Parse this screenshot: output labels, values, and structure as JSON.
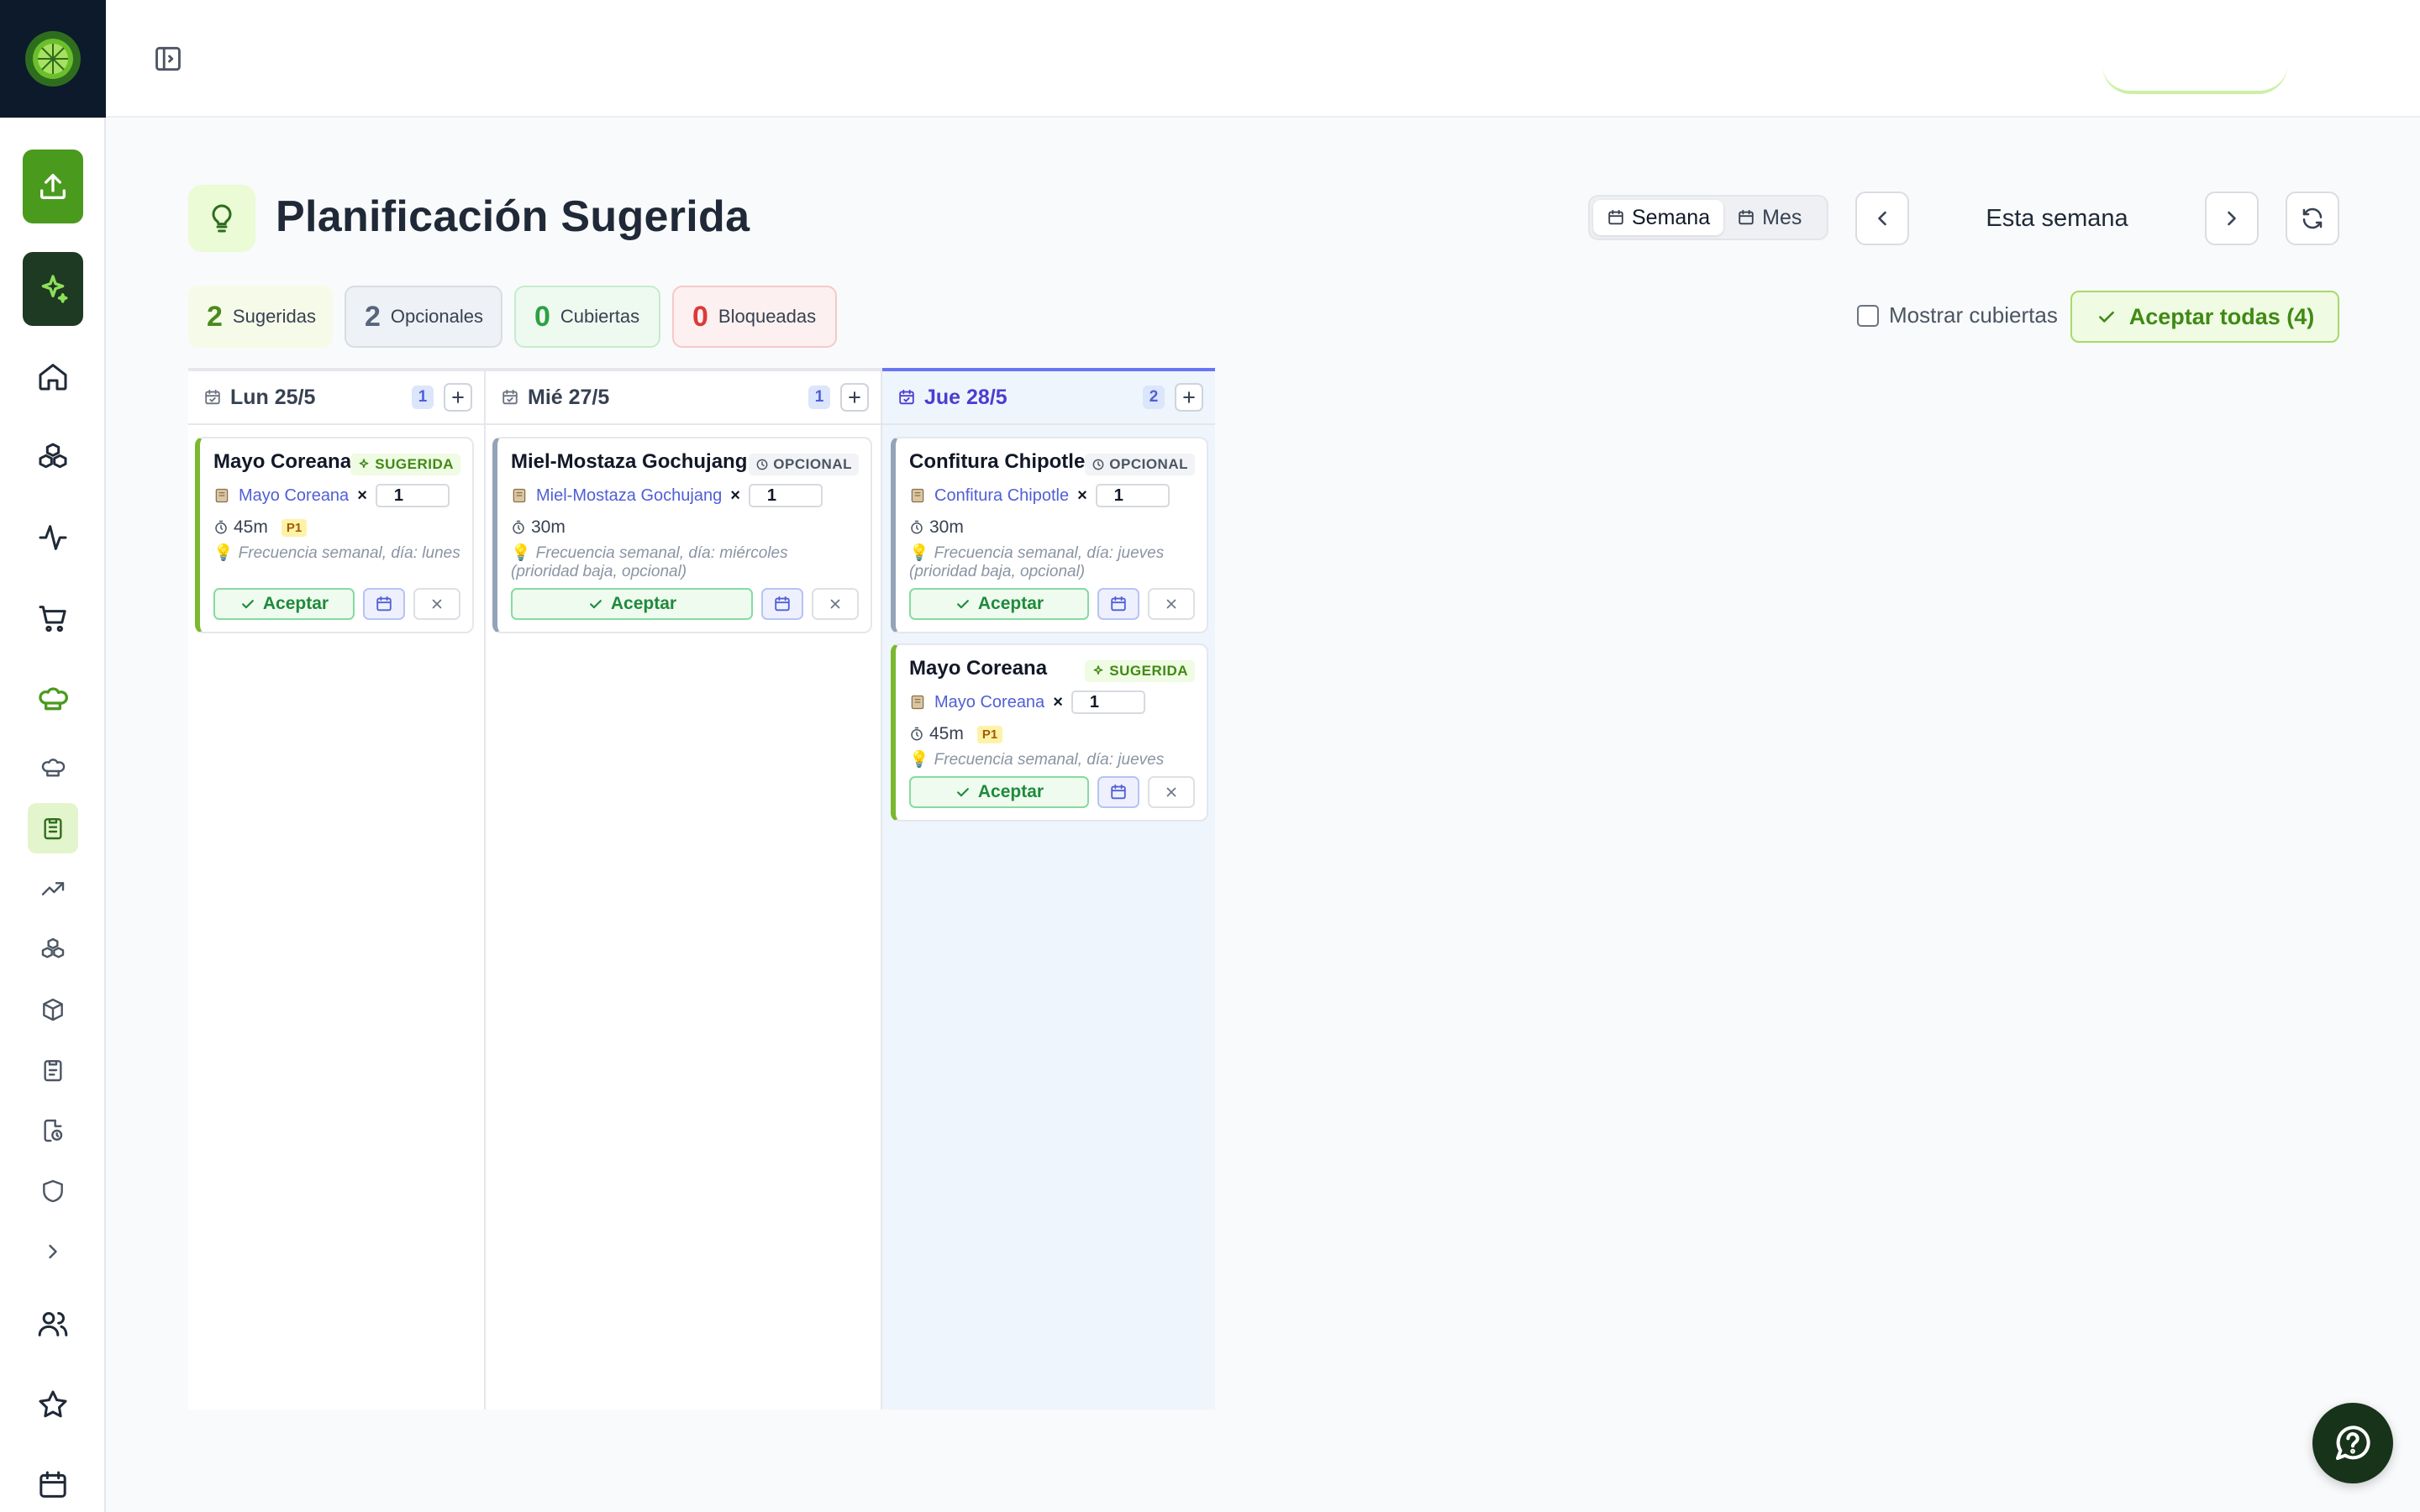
{
  "header": {
    "title": "Planificación Sugerida",
    "view_week": "Semana",
    "view_month": "Mes",
    "week_label": "Esta semana"
  },
  "stats": [
    {
      "num": "2",
      "label": "Sugeridas"
    },
    {
      "num": "2",
      "label": "Opcionales"
    },
    {
      "num": "0",
      "label": "Cubiertas"
    },
    {
      "num": "0",
      "label": "Bloqueadas"
    }
  ],
  "controls": {
    "show_covered": "Mostrar cubiertas",
    "accept_all": "Aceptar todas (4)"
  },
  "columns": [
    {
      "title": "Lun 25/5",
      "count": "1",
      "cards": [
        {
          "name": "Mayo Coreana",
          "badge": "SUGERIDA",
          "recipe": "Mayo Coreana",
          "qty": "1",
          "time": "45m",
          "priority": "P1",
          "reason": "Frecuencia semanal, día: lunes",
          "accept": "Aceptar"
        }
      ]
    },
    {
      "title": "Mié 27/5",
      "count": "1",
      "cards": [
        {
          "name": "Miel-Mostaza Gochujang",
          "badge": "OPCIONAL",
          "recipe": "Miel-Mostaza Gochujang",
          "qty": "1",
          "time": "30m",
          "reason": "Frecuencia semanal, día: miércoles (prioridad baja, opcional)",
          "accept": "Aceptar"
        }
      ]
    },
    {
      "title": "Jue 28/5",
      "count": "2",
      "cards": [
        {
          "name": "Confitura Chipotle",
          "badge": "OPCIONAL",
          "recipe": "Confitura Chipotle",
          "qty": "1",
          "time": "30m",
          "reason": "Frecuencia semanal, día: jueves (prioridad baja, opcional)",
          "accept": "Aceptar"
        },
        {
          "name": "Mayo Coreana",
          "badge": "SUGERIDA",
          "recipe": "Mayo Coreana",
          "qty": "1",
          "time": "45m",
          "priority": "P1",
          "reason": "Frecuencia semanal, día: jueves",
          "accept": "Aceptar"
        }
      ]
    }
  ],
  "colors": {
    "brand_green": "#3f8a16",
    "sidebar_dark": "#0c1a2b",
    "active_day": "#6875f5"
  }
}
